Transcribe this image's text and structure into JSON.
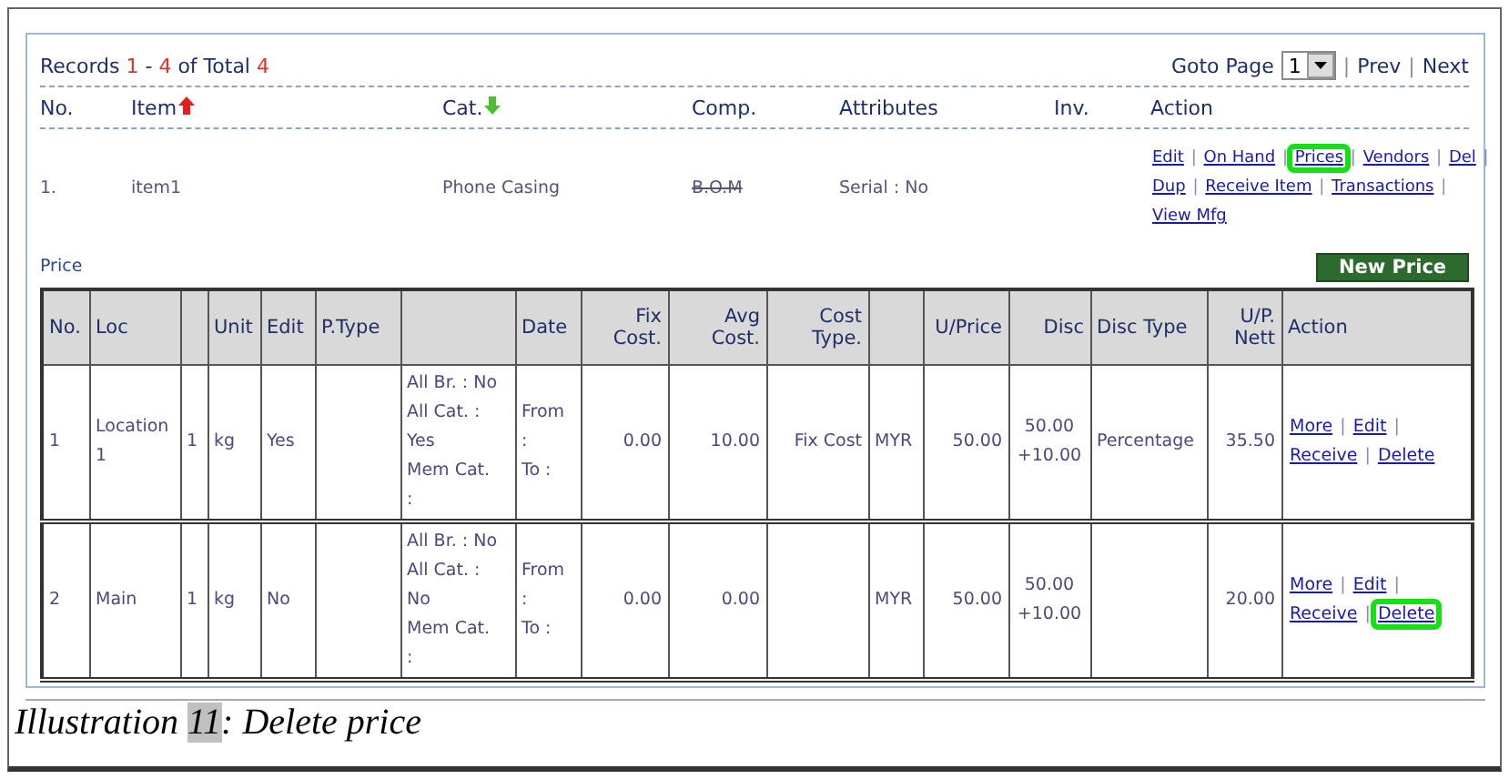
{
  "records": {
    "prefix": "Records",
    "first": "1",
    "dash": "-",
    "last": "4",
    "middle": "of Total",
    "total": "4"
  },
  "pager": {
    "label": "Goto Page",
    "page": "1",
    "separator": "|",
    "links": [
      "Prev",
      "Next"
    ]
  },
  "item_table": {
    "columns": [
      {
        "label": "No.",
        "sorted_up": false,
        "sorted_down": false
      },
      {
        "label": "Item",
        "sorted_up": true,
        "sorted_down": false
      },
      {
        "label": "Cat.",
        "sorted_up": false,
        "sorted_down": true
      },
      {
        "label": "Comp.",
        "sorted_up": false,
        "sorted_down": false
      },
      {
        "label": "Attributes",
        "sorted_up": false,
        "sorted_down": false
      },
      {
        "label": "Inv.",
        "sorted_up": false,
        "sorted_down": false
      },
      {
        "label": "Action",
        "sorted_up": false,
        "sorted_down": false
      }
    ],
    "rows": [
      {
        "no": "1.",
        "item": "item1",
        "category": "Phone Casing",
        "component": {
          "text": "B.O.M",
          "struck": true
        },
        "attributes": "Serial : No",
        "separator": "|",
        "actions": [
          {
            "label": "Edit",
            "highlighted": false
          },
          {
            "label": "On Hand",
            "highlighted": false
          },
          {
            "label": "Prices",
            "highlighted": true
          },
          {
            "label": "Vendors",
            "highlighted": false
          },
          {
            "label": "Del",
            "highlighted": false
          },
          {
            "label": "Dup",
            "highlighted": false
          },
          {
            "label": "Receive Item",
            "highlighted": false
          },
          {
            "label": "Transactions",
            "highlighted": false
          },
          {
            "label": "View Mfg",
            "highlighted": false
          }
        ]
      }
    ]
  },
  "price_section": {
    "title": "Price",
    "new_button": "New Price"
  },
  "price_table": {
    "columns": [
      {
        "label": "No."
      },
      {
        "label": "Loc"
      },
      {},
      {
        "label": "Unit"
      },
      {
        "label": "Edit"
      },
      {
        "label": "P.Type"
      },
      {},
      {
        "label": "Date"
      },
      {
        "label": "Fix Cost."
      },
      {
        "label": "Avg Cost."
      },
      {
        "label": "Cost Type."
      },
      {},
      {
        "label": "U/Price"
      },
      {
        "label": "Disc"
      },
      {
        "label": "Disc Type"
      },
      {
        "label": "U/P. Nett"
      },
      {
        "label": "Action"
      }
    ],
    "rows": [
      {
        "cells": [
          "1",
          "Location 1",
          "1",
          "kg",
          "Yes",
          "",
          [
            "All Br. : No",
            "All Cat. :",
            "Yes",
            "Mem Cat.",
            ":"
          ],
          [
            "From",
            ":",
            "To :"
          ],
          "0.00",
          "10.00",
          "Fix Cost",
          "MYR",
          "50.00",
          [
            "50.00",
            "+10.00"
          ],
          "Percentage",
          "35.50"
        ],
        "separator": "|",
        "actions": [
          {
            "label": "More",
            "highlighted": false
          },
          {
            "label": "Edit",
            "highlighted": false
          },
          {
            "label": "Receive",
            "highlighted": false
          },
          {
            "label": "Delete",
            "highlighted": false
          }
        ]
      },
      {
        "cells": [
          "2",
          "Main",
          "1",
          "kg",
          "No",
          "",
          [
            "All Br. : No",
            "All Cat. :",
            "No",
            "Mem Cat.",
            ":"
          ],
          [
            "From",
            ":",
            "To :"
          ],
          "0.00",
          "0.00",
          "",
          "MYR",
          "50.00",
          [
            "50.00",
            "+10.00"
          ],
          "",
          "20.00"
        ],
        "separator": "|",
        "actions": [
          {
            "label": "More",
            "highlighted": false
          },
          {
            "label": "Edit",
            "highlighted": false
          },
          {
            "label": "Receive",
            "highlighted": false
          },
          {
            "label": "Delete",
            "highlighted": true
          }
        ]
      }
    ]
  },
  "caption": {
    "label": "Illustration",
    "number": "11",
    "text": ": Delete price"
  }
}
